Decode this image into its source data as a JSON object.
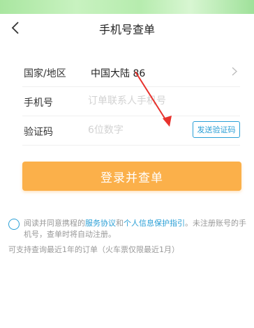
{
  "nav": {
    "title": "手机号查单",
    "back_icon": "chevron-left-icon"
  },
  "form": {
    "region": {
      "label": "国家/地区",
      "value": "中国大陆 86"
    },
    "phone": {
      "label": "手机号",
      "placeholder": "订单联系人手机号"
    },
    "code": {
      "label": "验证码",
      "placeholder": "6位数字",
      "send_label": "发送验证码"
    }
  },
  "login_button": "登录并查单",
  "agreement": {
    "prefix": "阅读并同意携程的",
    "link1": "服务协议",
    "and": "和",
    "link2": "个人信息保护指引",
    "suffix": "。未注册账号的手机号，查单时将自动注册。"
  },
  "support_note": "可支持查询最近1年的订单（火车票仅限最近1月）",
  "colors": {
    "accent": "#2a9fd6",
    "button": "#fbb04a",
    "annotation_arrow": "#e8322d"
  }
}
